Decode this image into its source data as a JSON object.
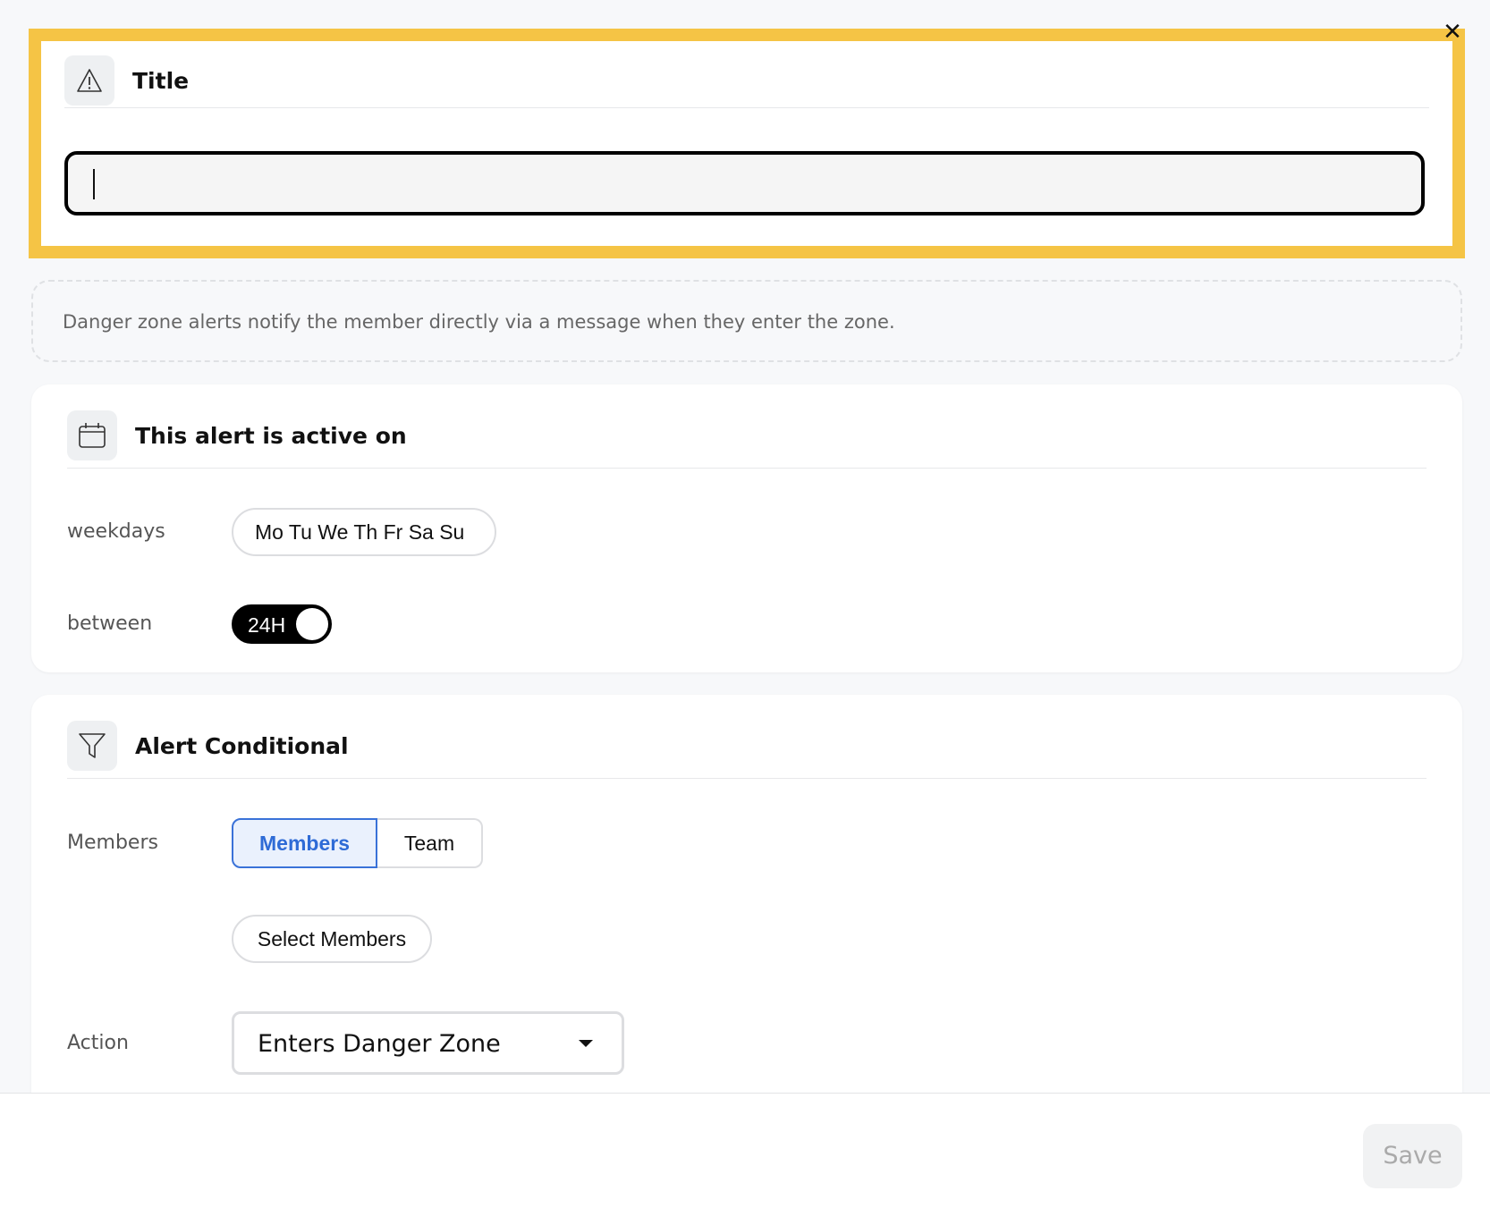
{
  "close": {
    "glyph": "✕"
  },
  "title_section": {
    "heading": "Title",
    "icon": "warning-triangle-icon",
    "value": ""
  },
  "info": {
    "text": "Danger zone alerts notify the member directly via a message when they enter the zone."
  },
  "schedule": {
    "heading": "This alert is active on",
    "icon": "calendar-icon",
    "weekdays_label": "weekdays",
    "weekdays_value": "Mo Tu We Th Fr Sa Su",
    "between_label": "between",
    "toggle_label": "24H",
    "toggle_on": true
  },
  "conditional": {
    "heading": "Alert Conditional",
    "icon": "funnel-icon",
    "members_label": "Members",
    "segments": [
      {
        "label": "Members",
        "active": true
      },
      {
        "label": "Team",
        "active": false
      }
    ],
    "select_members_label": "Select Members",
    "action_label": "Action",
    "action_value": "Enters Danger Zone"
  },
  "footer": {
    "save_label": "Save"
  },
  "colors": {
    "highlight": "#f5c445",
    "accent": "#2e6bd6"
  }
}
